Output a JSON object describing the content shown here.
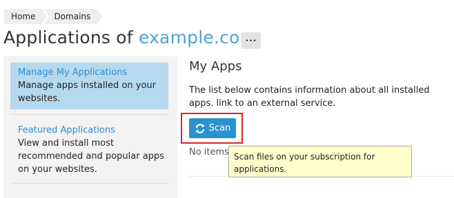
{
  "breadcrumb": {
    "items": [
      "Home",
      "Domains"
    ]
  },
  "header": {
    "title_prefix": "Applications of",
    "domain": "example.com",
    "more_label": "···"
  },
  "sidebar": {
    "items": [
      {
        "title": "Manage My Applications",
        "description": "Manage apps installed on your websites.",
        "active": true
      },
      {
        "title": "Featured Applications",
        "description": "View and install most recommended and popular apps on your websites.",
        "active": false
      }
    ]
  },
  "main": {
    "title": "My Apps",
    "description": "The list below contains information about all installed apps. link to an external service.",
    "scan_label": "Scan",
    "no_items": "No items",
    "tooltip": "Scan files on your subscription for applications."
  },
  "colors": {
    "accent": "#2a93cf",
    "link": "#2e8fd4",
    "active_item_bg": "#b5d9ee",
    "highlight_border": "#d9242c",
    "tooltip_bg": "#ffffcc"
  },
  "icons": {
    "scan": "refresh-icon"
  }
}
